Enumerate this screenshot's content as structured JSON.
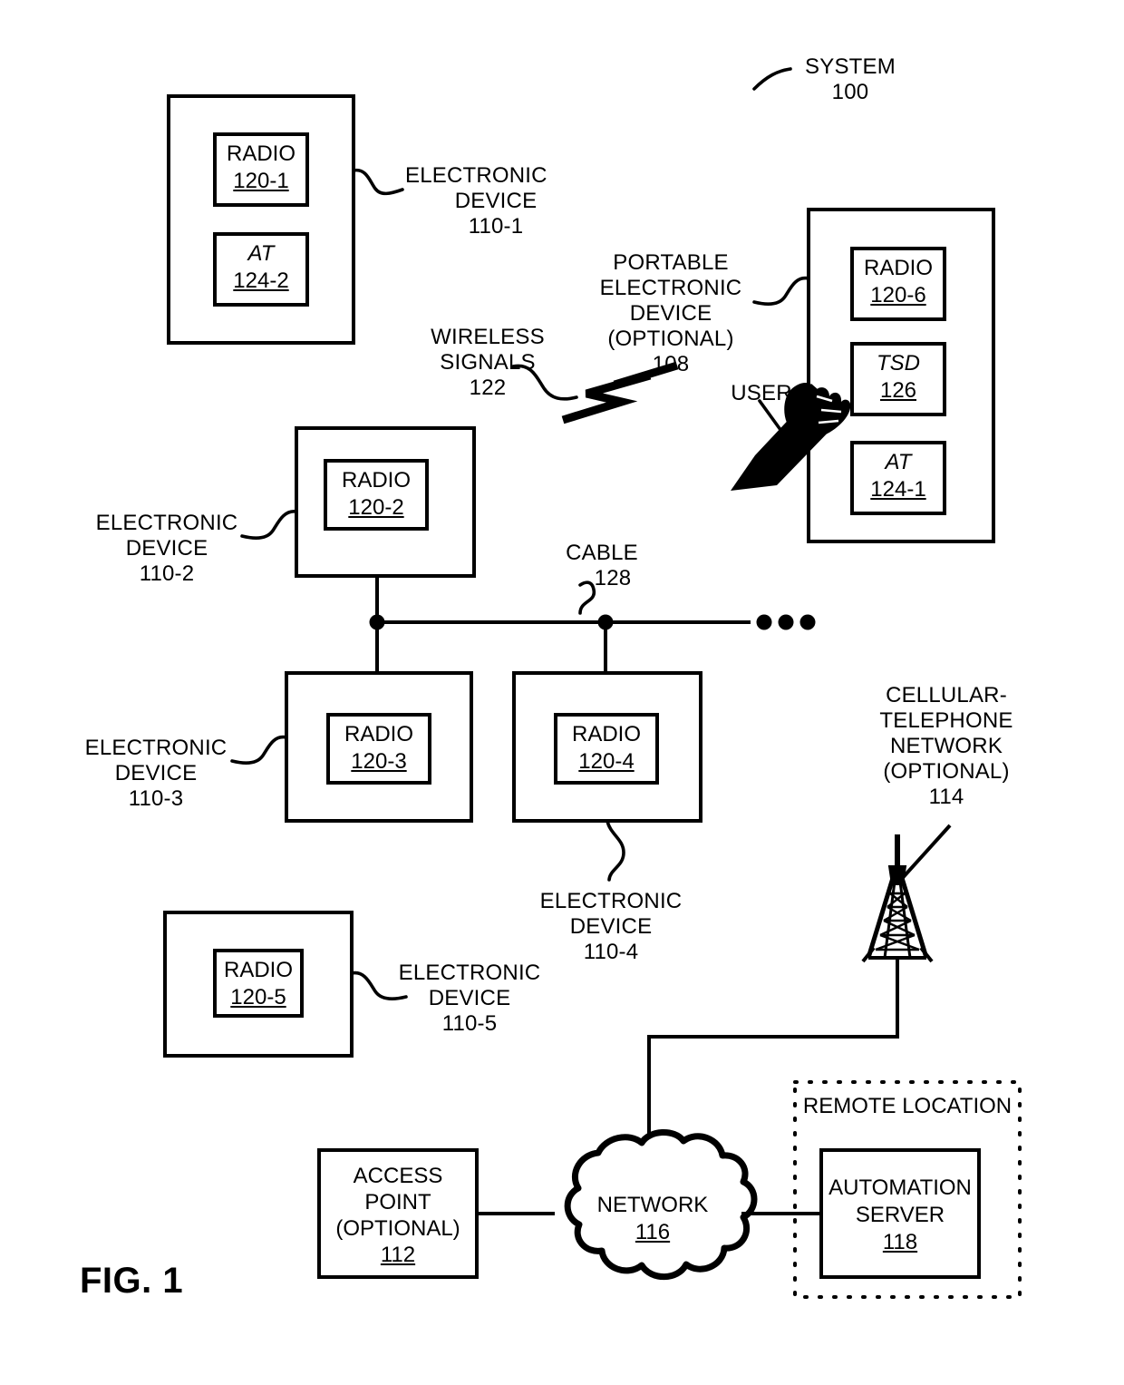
{
  "figure": {
    "label": "FIG. 1",
    "system_callout": {
      "title": "SYSTEM",
      "number": "100"
    }
  },
  "devices": [
    {
      "id": "110-1",
      "callout_lines": [
        "ELECTRONIC",
        "DEVICE",
        "110-1"
      ],
      "blocks": [
        {
          "name": "RADIO",
          "number": "120-1",
          "italic": false
        },
        {
          "name": "AT",
          "number": "124-2",
          "italic": true
        }
      ]
    },
    {
      "id": "110-2",
      "callout_lines": [
        "ELECTRONIC",
        "DEVICE",
        "110-2"
      ],
      "blocks": [
        {
          "name": "RADIO",
          "number": "120-2",
          "italic": false
        }
      ]
    },
    {
      "id": "110-3",
      "callout_lines": [
        "ELECTRONIC",
        "DEVICE",
        "110-3"
      ],
      "blocks": [
        {
          "name": "RADIO",
          "number": "120-3",
          "italic": false
        }
      ]
    },
    {
      "id": "110-4",
      "callout_lines": [
        "ELECTRONIC",
        "DEVICE",
        "110-4"
      ],
      "blocks": [
        {
          "name": "RADIO",
          "number": "120-4",
          "italic": false
        }
      ]
    },
    {
      "id": "110-5",
      "callout_lines": [
        "ELECTRONIC",
        "DEVICE",
        "110-5"
      ],
      "blocks": [
        {
          "name": "RADIO",
          "number": "120-5",
          "italic": false
        }
      ]
    }
  ],
  "portable_device": {
    "callout_lines": [
      "PORTABLE",
      "ELECTRONIC",
      "DEVICE",
      "(OPTIONAL)",
      "108"
    ],
    "blocks": [
      {
        "name": "RADIO",
        "number": "120-6",
        "italic": false
      },
      {
        "name": "TSD",
        "number": "126",
        "italic": true
      },
      {
        "name": "AT",
        "number": "124-1",
        "italic": true
      }
    ]
  },
  "user": {
    "label": "USER",
    "icon": "hand-pointing-icon"
  },
  "wireless_signals": {
    "label_lines": [
      "WIRELESS",
      "SIGNALS",
      "122"
    ],
    "icon": "lightning-bolt-icon"
  },
  "cable": {
    "label": "CABLE",
    "number": "128",
    "continuation": "•••"
  },
  "cellular_network": {
    "label_lines": [
      "CELLULAR-",
      "TELEPHONE",
      "NETWORK",
      "(OPTIONAL)",
      "114"
    ],
    "icon": "cell-tower-icon"
  },
  "access_point": {
    "lines": [
      "ACCESS",
      "POINT",
      "(OPTIONAL)"
    ],
    "number": "112"
  },
  "network_cloud": {
    "label": "NETWORK",
    "number": "116",
    "icon": "cloud-icon"
  },
  "remote_location": {
    "label": "REMOTE LOCATION",
    "server": {
      "lines": [
        "AUTOMATION",
        "SERVER"
      ],
      "number": "118"
    }
  },
  "colors": {
    "stroke": "#000000",
    "background": "#ffffff"
  }
}
